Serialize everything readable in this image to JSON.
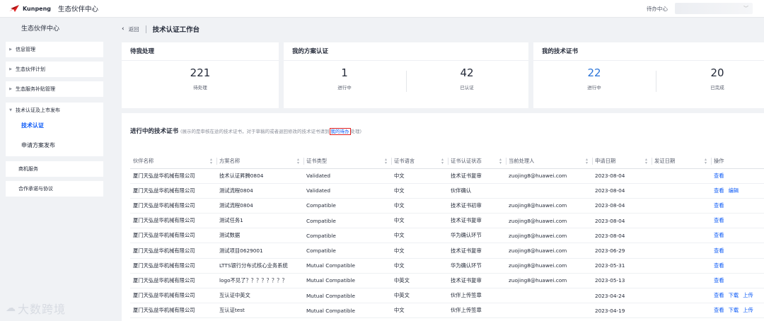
{
  "topbar": {
    "brand": "Kunpeng",
    "title": "生态伙伴中心",
    "todo_center": "待办中心"
  },
  "sidebar": {
    "title": "生态伙伴中心",
    "items": [
      {
        "label": "信息管理"
      },
      {
        "label": "生态伙伴计划"
      },
      {
        "label": "生态服务补贴管理"
      },
      {
        "label": "技术认证及上市发布"
      },
      {
        "label": "商机服务"
      },
      {
        "label": "合作承诺与协议"
      }
    ],
    "sub_items": [
      {
        "label": "技术认证",
        "active": true
      },
      {
        "label": "申请方案发布",
        "active": false
      }
    ]
  },
  "watermark": "大数跨境",
  "header": {
    "back_label": "返回",
    "page_title": "技术认证工作台"
  },
  "cards": {
    "pending": {
      "title": "待我处理",
      "value": "221",
      "label": "待处理"
    },
    "solutions": {
      "title": "我的方案认证",
      "stats": [
        {
          "value": "1",
          "label": "进行中"
        },
        {
          "value": "42",
          "label": "已认证"
        }
      ]
    },
    "certs": {
      "title": "我的技术证书",
      "stats": [
        {
          "value": "22",
          "label": "进行中"
        },
        {
          "value": "20",
          "label": "已完成"
        }
      ]
    }
  },
  "panel": {
    "title": "进行中的技术证书",
    "note_before": "(展示的是审核在途的技术证书，对于草稿的或者退回修改的技术证书请到",
    "note_link": "我的待办",
    "note_after": "处理)"
  },
  "table": {
    "columns": [
      "伙伴名称",
      "方案名称",
      "证书类型",
      "证书语言",
      "证书认证状态",
      "当前处理人",
      "申请日期",
      "发证日期",
      "操作"
    ],
    "rows": [
      {
        "partner": "厦门天弘益华机械有限公司",
        "solution": "技术认证昇腾0804",
        "type": "Validated",
        "lang": "中文",
        "status": "技术证书复审",
        "handler": "zuojing8@huawei.com",
        "apply": "2023-08-04",
        "issue": "",
        "actions": [
          "查看"
        ]
      },
      {
        "partner": "厦门天弘益华机械有限公司",
        "solution": "测试流程0804",
        "type": "Validated",
        "lang": "中文",
        "status": "伙伴确认",
        "handler": "",
        "apply": "2023-08-04",
        "issue": "",
        "actions": [
          "查看",
          "编辑"
        ]
      },
      {
        "partner": "厦门天弘益华机械有限公司",
        "solution": "测试流程0804",
        "type": "Compatible",
        "lang": "中文",
        "status": "技术证书初审",
        "handler": "zuojing8@huawei.com",
        "apply": "2023-08-04",
        "issue": "",
        "actions": [
          "查看"
        ]
      },
      {
        "partner": "厦门天弘益华机械有限公司",
        "solution": "测试任务1",
        "type": "Compatible",
        "lang": "中文",
        "status": "技术证书复审",
        "handler": "zuojing8@huawei.com",
        "apply": "2023-08-04",
        "issue": "",
        "actions": [
          "查看"
        ]
      },
      {
        "partner": "厦门天弘益华机械有限公司",
        "solution": "测试数据",
        "type": "Compatible",
        "lang": "中文",
        "status": "华为确认环节",
        "handler": "zuojing8@huawei.com",
        "apply": "2023-08-04",
        "issue": "",
        "actions": [
          "查看"
        ]
      },
      {
        "partner": "厦门天弘益华机械有限公司",
        "solution": "测试项目0629001",
        "type": "Compatible",
        "lang": "中文",
        "status": "技术证书复审",
        "handler": "zuojing8@huawei.com",
        "apply": "2023-06-29",
        "issue": "",
        "actions": [
          "查看"
        ]
      },
      {
        "partner": "厦门天弘益华机械有限公司",
        "solution": "LTTS银行分布式核心业务系统",
        "type": "Mutual Compatible",
        "lang": "中文",
        "status": "华为确认环节",
        "handler": "zuojing8@huawei.com",
        "apply": "2023-05-31",
        "issue": "",
        "actions": [
          "查看"
        ]
      },
      {
        "partner": "厦门天弘益华机械有限公司",
        "solution": "logo不见了？？？？？？？？",
        "type": "Mutual Compatible",
        "lang": "中英文",
        "status": "技术证书复审",
        "handler": "zuojing8@huawei.com",
        "apply": "2023-05-13",
        "issue": "",
        "actions": [
          "查看"
        ]
      },
      {
        "partner": "厦门天弘益华机械有限公司",
        "solution": "互认证中英文",
        "type": "Mutual Compatible",
        "lang": "中英文",
        "status": "伙伴上传签章",
        "handler": "",
        "apply": "2023-04-24",
        "issue": "",
        "actions": [
          "查看",
          "下载",
          "上传"
        ]
      },
      {
        "partner": "厦门天弘益华机械有限公司",
        "solution": "互认证test",
        "type": "Mutual Compatible",
        "lang": "中文",
        "status": "伙伴上传签章",
        "handler": "",
        "apply": "2023-04-19",
        "issue": "",
        "actions": [
          "查看",
          "下载",
          "上传"
        ]
      }
    ]
  },
  "colors": {
    "accent": "#0a59f7",
    "stat_blue": "#2b74d8",
    "highlight_border": "#e02020"
  }
}
